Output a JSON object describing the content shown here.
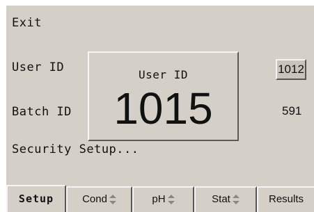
{
  "menu": {
    "exit_label": "Exit",
    "user_id_label": "User ID",
    "batch_id_label": "Batch ID",
    "security_setup_label": "Security Setup..."
  },
  "values": {
    "user_id_value": "1012",
    "batch_id_value": "591"
  },
  "popup": {
    "title": "User ID",
    "value": "1015"
  },
  "tabs": [
    {
      "label": "Setup",
      "active": true
    },
    {
      "label": "Cond",
      "icon": "up-down-arrow-icon"
    },
    {
      "label": "pH",
      "icon": "up-down-arrow-icon"
    },
    {
      "label": "Stat",
      "icon": "up-down-arrow-icon"
    },
    {
      "label": "Results"
    }
  ]
}
